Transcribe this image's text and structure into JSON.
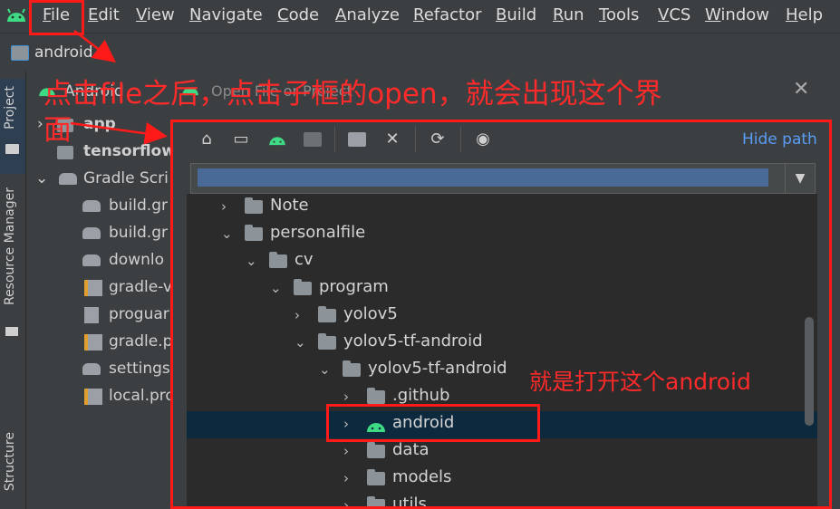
{
  "menu": {
    "items": [
      "File",
      "Edit",
      "View",
      "Navigate",
      "Code",
      "Analyze",
      "Refactor",
      "Build",
      "Run",
      "Tools",
      "VCS",
      "Window",
      "Help"
    ]
  },
  "navbar": {
    "project_name": "android"
  },
  "sidebar": {
    "tabs": [
      "Project",
      "Resource Manager",
      "Structure"
    ]
  },
  "project_panel": {
    "view_selector": "Android",
    "items": [
      "app",
      "tensorflow",
      "Gradle Scri",
      "build.gr",
      "build.gr",
      "downlo",
      "gradle-v",
      "proguar",
      "gradle.p",
      "settings",
      "local.pro"
    ]
  },
  "dialog": {
    "title": "Open File or Project",
    "hide_path_label": "Hide path",
    "dropdown_glyph": "▼",
    "tree": [
      {
        "label": "Note",
        "depth": 1,
        "expanded": false
      },
      {
        "label": "personalfile",
        "depth": 1,
        "expanded": true
      },
      {
        "label": "cv",
        "depth": 2,
        "expanded": true
      },
      {
        "label": "program",
        "depth": 3,
        "expanded": true
      },
      {
        "label": "yolov5",
        "depth": 4,
        "expanded": false
      },
      {
        "label": "yolov5-tf-android",
        "depth": 4,
        "expanded": true
      },
      {
        "label": "yolov5-tf-android",
        "depth": 5,
        "expanded": true
      },
      {
        "label": ".github",
        "depth": 6,
        "expanded": false
      },
      {
        "label": "android",
        "depth": 6,
        "expanded": false,
        "selected": true,
        "android": true
      },
      {
        "label": "data",
        "depth": 6,
        "expanded": false
      },
      {
        "label": "models",
        "depth": 6,
        "expanded": false
      },
      {
        "label": "utils",
        "depth": 6,
        "expanded": false
      }
    ]
  },
  "annotations": {
    "top_text_line1": "点击file之后，点击子框的open，就会出现这个界",
    "top_text_line2": "面",
    "side_text": "就是打开这个android"
  },
  "colors": {
    "annotation_red": "#ff1a1a",
    "link_blue": "#589df6",
    "android_green": "#3ddc84",
    "selection": "#0d293e"
  }
}
